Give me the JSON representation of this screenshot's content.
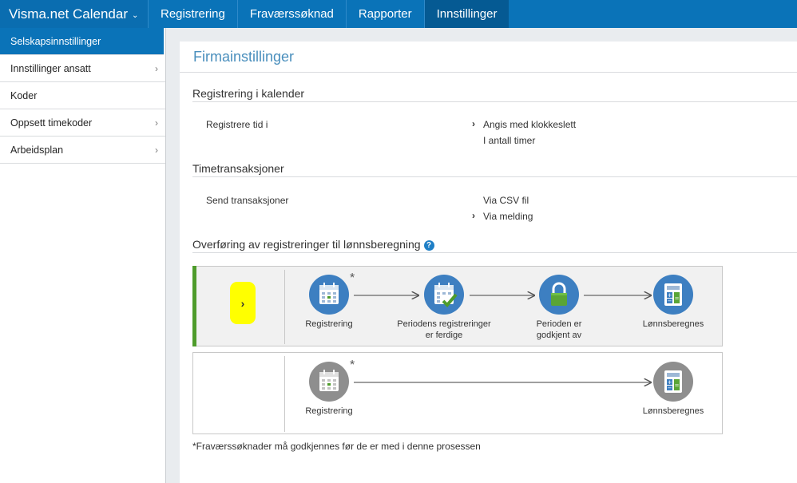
{
  "header": {
    "brand": "Visma.net Calendar",
    "brand_chevron_icon": "chevron-down-icon",
    "tabs": [
      {
        "label": "Registrering",
        "active": false
      },
      {
        "label": "Fraværssøknad",
        "active": false
      },
      {
        "label": "Rapporter",
        "active": false
      },
      {
        "label": "Innstillinger",
        "active": true
      }
    ]
  },
  "sidebar": {
    "items": [
      {
        "label": "Selskapsinnstillinger",
        "active": true,
        "has_arrow": false
      },
      {
        "label": "Innstillinger ansatt",
        "active": false,
        "has_arrow": true
      },
      {
        "label": "Koder",
        "active": false,
        "has_arrow": false
      },
      {
        "label": "Oppsett timekoder",
        "active": false,
        "has_arrow": true
      },
      {
        "label": "Arbeidsplan",
        "active": false,
        "has_arrow": true
      }
    ]
  },
  "main": {
    "title": "Firmainstillinger",
    "section1": {
      "heading": "Registrering i kalender",
      "field_label": "Registrere tid i",
      "options": [
        {
          "label": "Angis med klokkeslett",
          "selected": true
        },
        {
          "label": "I antall timer",
          "selected": false
        }
      ]
    },
    "section2": {
      "heading": "Timetransaksjoner",
      "field_label": "Send transaksjoner",
      "options": [
        {
          "label": "Via CSV fil",
          "selected": false
        },
        {
          "label": "Via melding",
          "selected": true
        }
      ]
    },
    "section3": {
      "heading": "Overføring av registreringer til lønnsberegning",
      "help_icon": "help-icon",
      "process1": {
        "selected": true,
        "steps": [
          {
            "label": "Registrering",
            "icon": "calendar-icon",
            "asterisk": "*"
          },
          {
            "label": "Periodens registreringer er ferdige",
            "icon": "calendar-check-icon"
          },
          {
            "label": "Perioden er godkjent av",
            "icon": "lock-icon"
          },
          {
            "label": "Lønnsberegnes",
            "icon": "calculator-icon"
          }
        ]
      },
      "process2": {
        "selected": false,
        "steps": [
          {
            "label": "Registrering",
            "icon": "calendar-icon",
            "asterisk": "*"
          },
          {
            "label": "Lønnsberegnes",
            "icon": "calculator-icon"
          }
        ]
      }
    },
    "footnote": "*Fraværssøknader må godkjennes før de er med i denne prosessen"
  },
  "colors": {
    "nav": "#0a73b8",
    "nav_active": "#055a93",
    "title": "#4a8fbd",
    "icon_blue": "#3d7fc1",
    "icon_gray": "#8e8e8e",
    "selected_bar": "#4e9c2b",
    "highlight": "#ffff00"
  }
}
